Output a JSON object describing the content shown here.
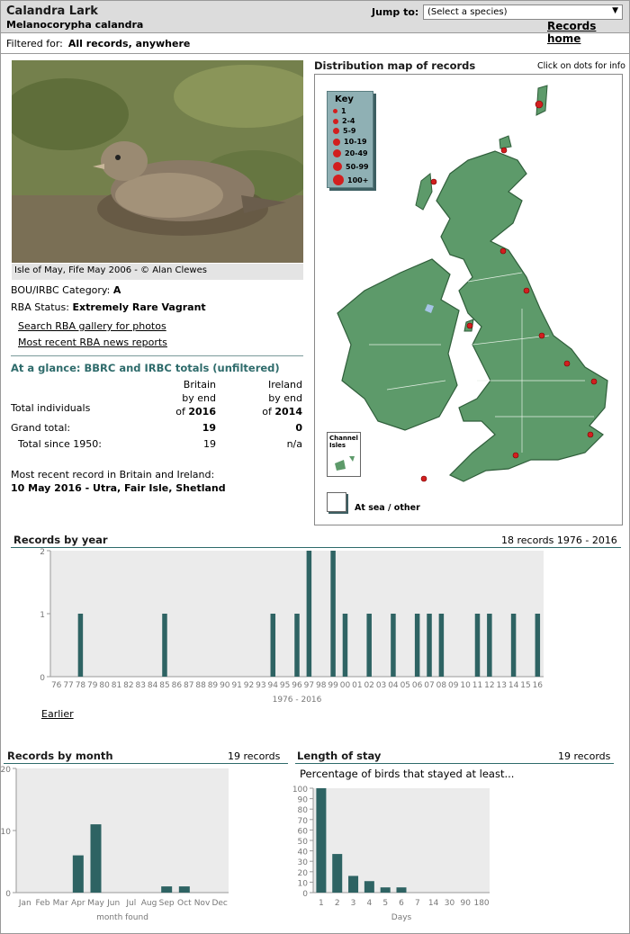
{
  "species": {
    "common": "Calandra Lark",
    "scientific": "Melanocorypha calandra"
  },
  "nav": {
    "jump_label": "Jump to:",
    "select_placeholder": "(Select a species)",
    "records_home": "Records home"
  },
  "filter": {
    "label": "Filtered for:",
    "value": "All records, anywhere"
  },
  "photo": {
    "caption": "Isle of May, Fife May 2006 - © Alan Clewes"
  },
  "status": {
    "category_label": "BOU/IRBC Category:",
    "category": "A",
    "rba_label": "RBA Status:",
    "rba": "Extremely Rare Vagrant"
  },
  "links": {
    "gallery": "Search RBA gallery for photos",
    "news": "Most recent RBA news reports",
    "earlier": "Earlier"
  },
  "glance": {
    "title": "At a glance: BBRC and IRBC totals (unfiltered)",
    "britain_head": [
      "Britain",
      "by end",
      "of"
    ],
    "britain_year": "2016",
    "ireland_head": [
      "Ireland",
      "by end",
      "of"
    ],
    "ireland_year": "2014",
    "row_total_label": "Total individuals",
    "grand_label": "Grand total:",
    "grand_britain": "19",
    "grand_ireland": "0",
    "since_label": "Total since 1950:",
    "since_britain": "19",
    "since_ireland": "n/a",
    "recent_label": "Most recent record in Britain and Ireland:",
    "recent_value": "10 May 2016  - Utra, Fair Isle, Shetland"
  },
  "map": {
    "title": "Distribution map of records",
    "hint": "Click on dots for info",
    "key_title": "Key",
    "key": [
      "1",
      "2-4",
      "5-9",
      "10-19",
      "20-49",
      "50-99",
      "100+"
    ],
    "channel_label": "Channel Isles",
    "at_sea": "At sea / other",
    "colors": {
      "land": "#5d9a6a",
      "dot": "#d21f1f",
      "key_bg": "#8fb0b4"
    }
  },
  "year_chart": {
    "title": "Records by year",
    "summary": "18 records 1976 - 2016"
  },
  "month_chart": {
    "title": "Records by month",
    "summary": "19 records"
  },
  "stay_chart": {
    "title": "Length of stay",
    "summary": "19 records",
    "subtitle": "Percentage of birds that stayed at least..."
  },
  "chart_data": [
    {
      "type": "bar",
      "title": "Records by year",
      "xlabel": "1976 - 2016",
      "ylim": [
        0,
        2
      ],
      "yticks": [
        0,
        1,
        2
      ],
      "categories": [
        "76",
        "77",
        "78",
        "79",
        "80",
        "81",
        "82",
        "83",
        "84",
        "85",
        "86",
        "87",
        "88",
        "89",
        "90",
        "91",
        "92",
        "93",
        "94",
        "95",
        "96",
        "97",
        "98",
        "99",
        "00",
        "01",
        "02",
        "03",
        "04",
        "05",
        "06",
        "07",
        "08",
        "09",
        "10",
        "11",
        "12",
        "13",
        "14",
        "15",
        "16"
      ],
      "values": [
        0,
        0,
        1,
        0,
        0,
        0,
        0,
        0,
        0,
        1,
        0,
        0,
        0,
        0,
        0,
        0,
        0,
        0,
        1,
        0,
        1,
        2,
        0,
        2,
        1,
        0,
        1,
        0,
        1,
        0,
        1,
        1,
        1,
        0,
        0,
        1,
        1,
        0,
        1,
        0,
        1
      ]
    },
    {
      "type": "bar",
      "title": "Records by month",
      "xlabel": "month found",
      "ylim": [
        0,
        20
      ],
      "yticks": [
        0,
        10,
        20
      ],
      "categories": [
        "Jan",
        "Feb",
        "Mar",
        "Apr",
        "May",
        "Jun",
        "Jul",
        "Aug",
        "Sep",
        "Oct",
        "Nov",
        "Dec"
      ],
      "values": [
        0,
        0,
        0,
        6,
        11,
        0,
        0,
        0,
        1,
        1,
        0,
        0
      ]
    },
    {
      "type": "bar",
      "title": "Length of stay",
      "xlabel": "Days",
      "ylim": [
        0,
        100
      ],
      "yticks": [
        0,
        10,
        20,
        30,
        40,
        50,
        60,
        70,
        80,
        90,
        100
      ],
      "categories": [
        "1",
        "2",
        "3",
        "4",
        "5",
        "6",
        "7",
        "14",
        "30",
        "90",
        "180"
      ],
      "values": [
        100,
        37,
        16,
        11,
        5,
        5,
        0,
        0,
        0,
        0,
        0
      ]
    }
  ]
}
